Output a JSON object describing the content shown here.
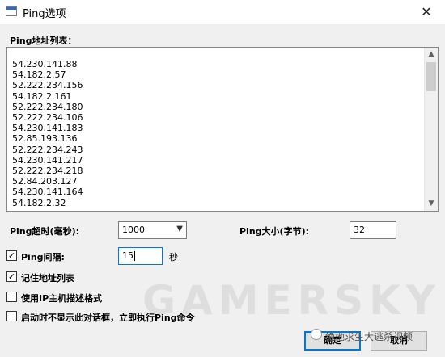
{
  "window": {
    "title": "Ping选项",
    "close": "✕"
  },
  "address_list": {
    "label": "Ping地址列表：",
    "items": [
      "54.230.141.88",
      "54.182.2.57",
      "52.222.234.156",
      "54.182.2.161",
      "52.222.234.180",
      "52.222.234.106",
      "54.230.141.183",
      "52.85.193.136",
      "52.222.234.243",
      "54.230.141.217",
      "52.222.234.218",
      "52.84.203.127",
      "54.230.141.164",
      "54.182.2.32"
    ]
  },
  "timeout": {
    "label": "Ping超时(毫秒):",
    "value": "1000"
  },
  "size": {
    "label": "Ping大小(字节):",
    "value": "32"
  },
  "interval": {
    "checked": true,
    "label": "Ping间隔:",
    "value": "15",
    "unit": "秒"
  },
  "options": [
    {
      "checked": true,
      "label": "记住地址列表"
    },
    {
      "checked": false,
      "label": "使用IP主机描述格式"
    },
    {
      "checked": false,
      "label": "启动时不显示此对话框，立即执行Ping命令"
    }
  ],
  "buttons": {
    "ok": "确定",
    "cancel": "取消"
  },
  "watermark": {
    "text": "GAMERSKY",
    "caption": "绝地求生大逃杀视频"
  },
  "colors": {
    "focus": "#0078d7",
    "dialog_bg": "#f0f0f0"
  },
  "icons": {
    "app": "window-icon",
    "close": "close-icon",
    "scroll_up": "chevron-up-icon",
    "scroll_down": "chevron-down-icon",
    "dropdown": "chevron-down-icon",
    "check": "checkmark-icon"
  }
}
